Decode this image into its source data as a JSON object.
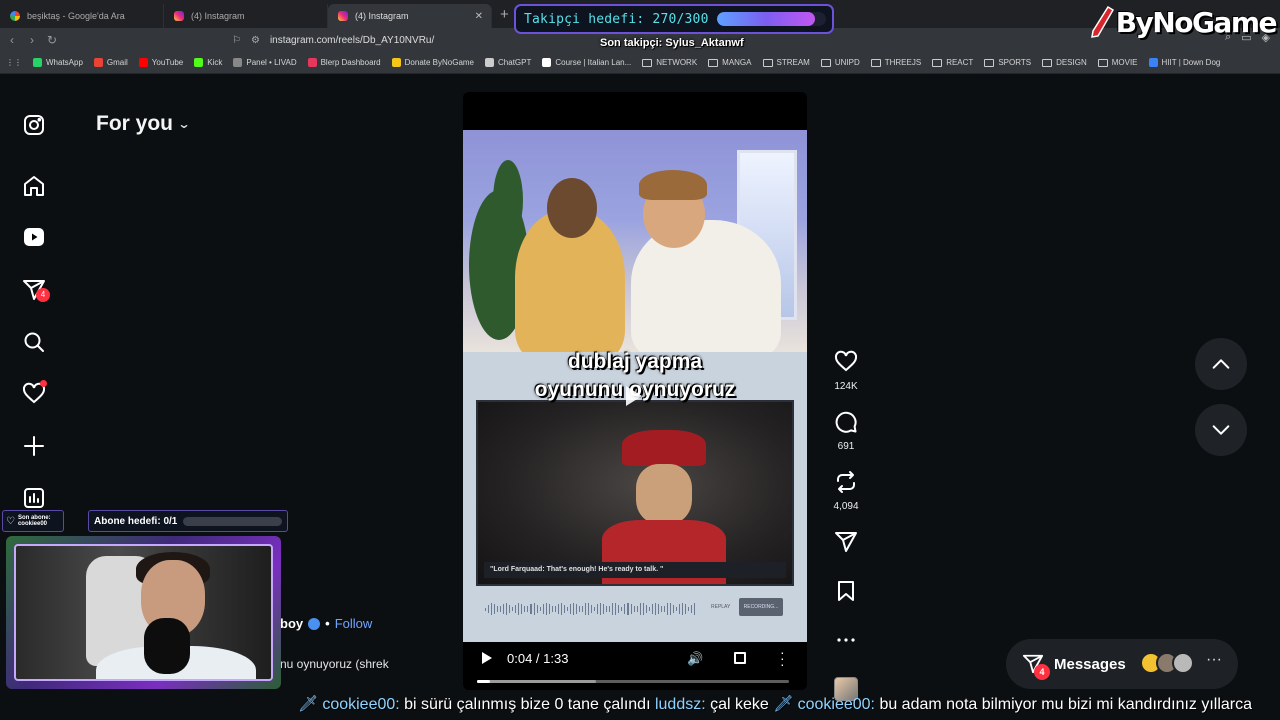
{
  "browser": {
    "tabs": [
      {
        "title": "beşiktaş - Google'da Ara",
        "favicon": "google-icon",
        "active": false
      },
      {
        "title": "(4) Instagram",
        "favicon": "instagram-icon",
        "active": false
      },
      {
        "title": "(4) Instagram",
        "favicon": "instagram-icon",
        "active": true
      }
    ],
    "url": "instagram.com/reels/Db_AY10NVRu/",
    "bookmarks": [
      {
        "label": "WhatsApp",
        "color": "#25d366"
      },
      {
        "label": "Gmail",
        "color": "#ea4335"
      },
      {
        "label": "YouTube",
        "color": "#ff0000"
      },
      {
        "label": "Kick",
        "color": "#53fc18"
      },
      {
        "label": "Panel • LIVAD",
        "color": "#888888"
      },
      {
        "label": "Blerp Dashboard",
        "color": "#e8365d"
      },
      {
        "label": "Donate ByNoGame",
        "color": "#f5c518"
      },
      {
        "label": "ChatGPT",
        "color": "#cccccc"
      },
      {
        "label": "Course | Italian Lan...",
        "color": "#ffffff"
      },
      {
        "label": "NETWORK",
        "folder": true
      },
      {
        "label": "MANGA",
        "folder": true
      },
      {
        "label": "STREAM",
        "folder": true
      },
      {
        "label": "UNIPD",
        "folder": true
      },
      {
        "label": "THREEJS",
        "folder": true
      },
      {
        "label": "REACT",
        "folder": true
      },
      {
        "label": "SPORTS",
        "folder": true
      },
      {
        "label": "DESIGN",
        "folder": true
      },
      {
        "label": "MOVIE",
        "folder": true
      },
      {
        "label": "HIIT | Down Dog",
        "color": "#3b82f6"
      }
    ]
  },
  "overlay": {
    "follow_goal_text": "Takipçi hedefi: 270/300",
    "follow_goal_progress": 0.9,
    "last_follower": "Son takipçi: Sylus_Aktanwf",
    "logo_text": "ByNoGame",
    "sub_last_label": "Son abone:",
    "sub_last_name": "cookiee00",
    "sub_goal_text": "Abone hedefi: 0/1",
    "sub_goal_progress": 0
  },
  "instagram": {
    "feed_title": "For you",
    "notification_count": "4",
    "reel": {
      "caption_line1": "dublaj yapma",
      "caption_line2": "oyununu oynuyoruz",
      "inner_caption": "\"Lord Farquaad: That's enough! He's ready to talk. \"",
      "recording_label": "RECORDING...",
      "replay_label": "REPLAY",
      "time": "0:04 / 1:33",
      "progress": 0.043,
      "buffered": 0.38
    },
    "likes": "124K",
    "comments": "691",
    "reposts": "4,094",
    "author_partial": "boy",
    "follow_label": "Follow",
    "description_partial": "nu oynuyoruz (shrek",
    "messages_label": "Messages",
    "messages_badge": "4"
  },
  "chat": [
    {
      "user": "cookiee00:",
      "text": "bi sürü çalınmış bize 0 tane çalındı"
    },
    {
      "user": "luddsz:",
      "text": "çal keke"
    },
    {
      "user": "cookiee00:",
      "text": "bu adam nota bilmiyor mu bizi mi kandırdınız yıllarca"
    }
  ]
}
